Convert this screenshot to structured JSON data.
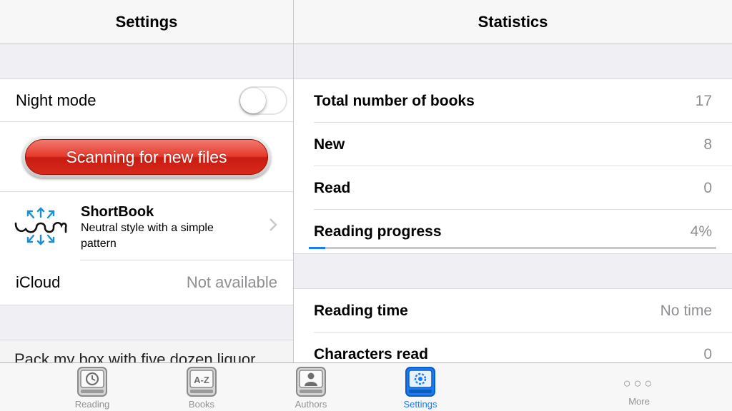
{
  "settings": {
    "title": "Settings",
    "night_mode_label": "Night mode",
    "night_mode_on": false,
    "scan_button_label": "Scanning for new files",
    "theme": {
      "name": "ShortBook",
      "description": "Neutral style with a simple pattern",
      "logo_icon": "snowflake-logo-icon"
    },
    "icloud_label": "iCloud",
    "icloud_value": "Not available",
    "partial_text": "Pack my box with five dozen liquor"
  },
  "statistics": {
    "title": "Statistics",
    "group1": [
      {
        "label": "Total number of books",
        "value": "17"
      },
      {
        "label": "New",
        "value": "8"
      },
      {
        "label": "Read",
        "value": "0"
      }
    ],
    "progress": {
      "label": "Reading progress",
      "value": "4%",
      "fraction": 0.04
    },
    "group2": [
      {
        "label": "Reading time",
        "value": "No time"
      },
      {
        "label": "Characters read",
        "value": "0"
      }
    ]
  },
  "tabbar": {
    "active": "Settings",
    "tabs": [
      {
        "label": "Reading",
        "icon": "clock-book-icon"
      },
      {
        "label": "Books",
        "icon": "a-z-book-icon"
      },
      {
        "label": "Authors",
        "icon": "person-book-icon"
      },
      {
        "label": "Settings",
        "icon": "gear-book-icon"
      },
      {
        "label": "More",
        "icon": "more-dots-icon"
      }
    ]
  },
  "colors": {
    "accent": "#1a7bf2",
    "scan_button_red": "#e43a2b",
    "secondary_text": "#8e8e93",
    "background": "#efeff4"
  }
}
